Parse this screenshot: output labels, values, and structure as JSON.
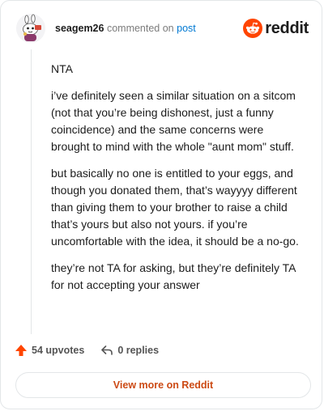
{
  "header": {
    "username": "seagem26",
    "action": "commented on",
    "post_link": "post",
    "brand": "reddit",
    "avatar_icon": "snoo-avatar-icon",
    "brand_icon": "reddit-logo-icon"
  },
  "comment": {
    "paragraphs": [
      "NTA",
      "i’ve definitely seen a similar situation on a sitcom (not that you’re being dishonest, just a funny coincidence) and the same concerns were brought to mind with the whole \"aunt mom\" stuff.",
      "but basically no one is entitled to your eggs, and though you donated them, that’s wayyyy different than giving them to your brother to raise a child that’s yours but also not yours. if you’re uncomfortable with the idea, it should be a no-go.",
      "they’re not TA for asking, but they’re definitely TA for not accepting your answer"
    ]
  },
  "footer": {
    "upvotes": "54 upvotes",
    "replies": "0 replies",
    "upvote_icon": "upvote-arrow-icon",
    "reply_icon": "reply-icon"
  },
  "cta": {
    "label": "View more on Reddit"
  },
  "colors": {
    "accent": "#ff4500",
    "link": "#0079d3",
    "cta": "#cc4a14",
    "muted": "#7c7c7c",
    "border": "#e3e6e8"
  }
}
